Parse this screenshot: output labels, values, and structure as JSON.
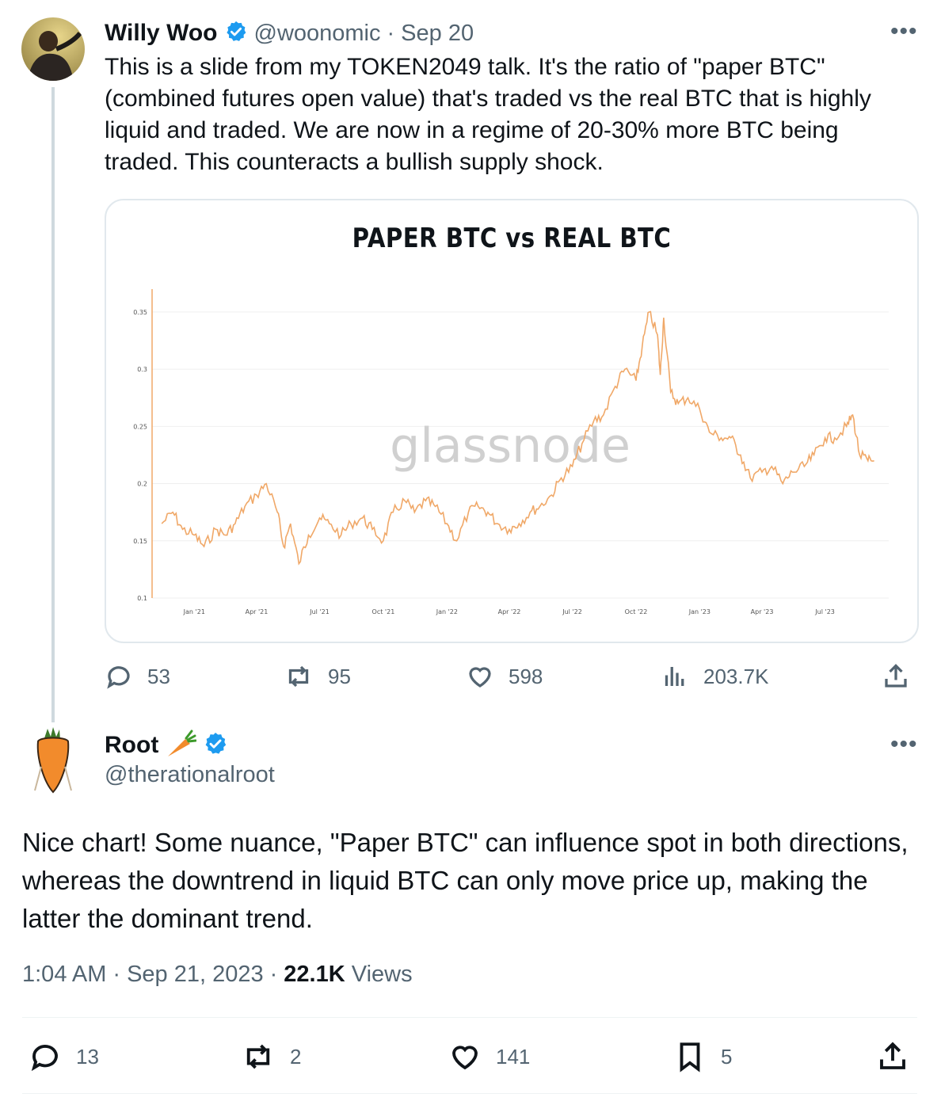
{
  "tweet1": {
    "author_name": "Willy Woo",
    "handle": "@woonomic",
    "separator": "·",
    "date": "Sep 20",
    "text": "This is a slide from my TOKEN2049 talk. It's the ratio of \"paper BTC\" (combined futures open value) that's traded vs the real BTC that is highly liquid and traded. We are now in a regime of 20-30% more BTC being traded. This counteracts a bullish supply shock.",
    "stats": {
      "replies": "53",
      "reposts": "95",
      "likes": "598",
      "views": "203.7K"
    }
  },
  "tweet2": {
    "author_name": "Root",
    "handle": "@therationalroot",
    "text": "Nice chart! Some nuance, \"Paper BTC\" can influence spot in both directions, whereas the downtrend in liquid BTC can only move price up, making the latter the dominant trend.",
    "time": "1:04 AM",
    "sep1": "·",
    "date": "Sep 21, 2023",
    "sep2": "·",
    "views_count": "22.1K",
    "views_label": "Views",
    "stats": {
      "replies": "13",
      "reposts": "2",
      "likes": "141",
      "bookmarks": "5"
    }
  },
  "colors": {
    "accent": "#1d9bf0",
    "line": "#f0a868",
    "muted": "#536471"
  },
  "chart_data": {
    "type": "line",
    "title": "PAPER BTC vs REAL BTC",
    "watermark": "glassnode",
    "ylim": [
      0.1,
      0.37
    ],
    "yticks": [
      "0.35",
      "0.3",
      "0.25",
      "0.2",
      "0.15",
      "0.1"
    ],
    "xticks": [
      "Jan '21",
      "Apr '21",
      "Jul '21",
      "Oct '21",
      "Jan '22",
      "Apr '22",
      "Jul '22",
      "Oct '22",
      "Jan '23",
      "Apr '23",
      "Jul '23"
    ],
    "grid": true,
    "series": [
      {
        "x": [
          "2020-11-15",
          "2020-12-01",
          "2020-12-15",
          "2021-01-01",
          "2021-01-15",
          "2021-02-01",
          "2021-02-15",
          "2021-03-01",
          "2021-03-15",
          "2021-04-01",
          "2021-04-15",
          "2021-05-01",
          "2021-05-10",
          "2021-05-20",
          "2021-06-01",
          "2021-06-15",
          "2021-07-01",
          "2021-07-15",
          "2021-08-01",
          "2021-08-15",
          "2021-09-01",
          "2021-09-15",
          "2021-10-01",
          "2021-10-15",
          "2021-11-01",
          "2021-11-15",
          "2021-12-01",
          "2021-12-15",
          "2022-01-01",
          "2022-01-15",
          "2022-02-01",
          "2022-02-15",
          "2022-03-01",
          "2022-03-15",
          "2022-04-01",
          "2022-04-15",
          "2022-05-01",
          "2022-05-15",
          "2022-06-01",
          "2022-06-15",
          "2022-07-01",
          "2022-07-15",
          "2022-08-01",
          "2022-08-15",
          "2022-09-01",
          "2022-09-15",
          "2022-10-01",
          "2022-10-10",
          "2022-10-20",
          "2022-11-01",
          "2022-11-05",
          "2022-11-10",
          "2022-11-20",
          "2022-12-01",
          "2022-12-15",
          "2023-01-01",
          "2023-01-15",
          "2023-02-01",
          "2023-02-15",
          "2023-03-01",
          "2023-03-15",
          "2023-04-01",
          "2023-04-15",
          "2023-05-01",
          "2023-05-15",
          "2023-06-01",
          "2023-06-15",
          "2023-07-01",
          "2023-07-15",
          "2023-08-01",
          "2023-08-10",
          "2023-08-20",
          "2023-09-01",
          "2023-09-10"
        ],
        "y": [
          0.165,
          0.175,
          0.16,
          0.155,
          0.145,
          0.16,
          0.155,
          0.165,
          0.18,
          0.19,
          0.2,
          0.175,
          0.145,
          0.165,
          0.13,
          0.155,
          0.17,
          0.165,
          0.155,
          0.165,
          0.17,
          0.16,
          0.15,
          0.175,
          0.185,
          0.175,
          0.185,
          0.18,
          0.165,
          0.15,
          0.175,
          0.18,
          0.175,
          0.165,
          0.16,
          0.165,
          0.175,
          0.18,
          0.19,
          0.205,
          0.215,
          0.235,
          0.255,
          0.26,
          0.285,
          0.3,
          0.29,
          0.32,
          0.35,
          0.33,
          0.295,
          0.345,
          0.28,
          0.27,
          0.275,
          0.265,
          0.245,
          0.24,
          0.24,
          0.225,
          0.205,
          0.21,
          0.215,
          0.2,
          0.21,
          0.215,
          0.225,
          0.24,
          0.24,
          0.25,
          0.26,
          0.225,
          0.22,
          0.22
        ]
      }
    ]
  }
}
